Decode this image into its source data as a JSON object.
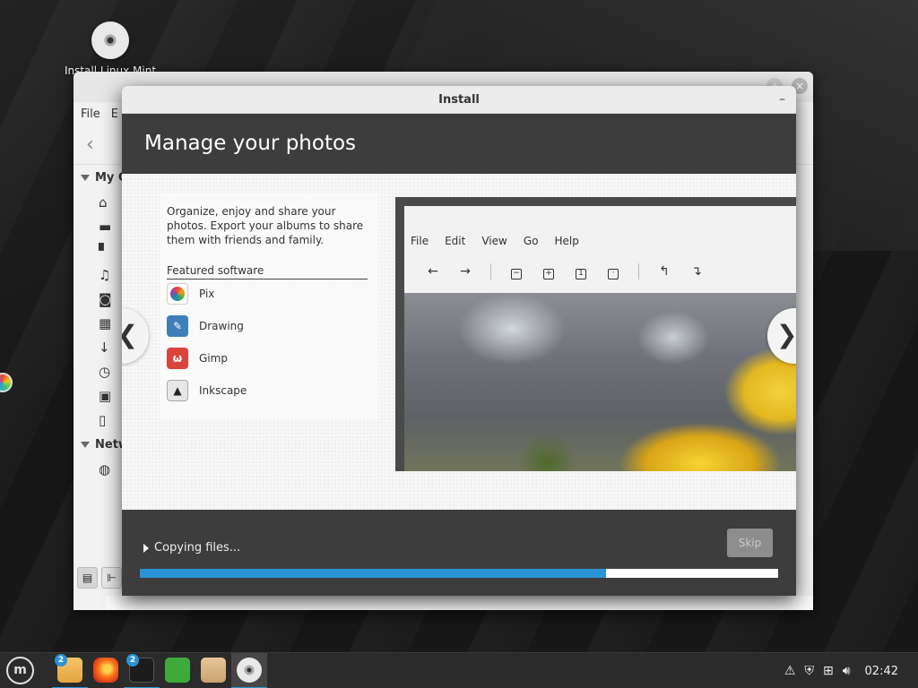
{
  "desktop": {
    "icon_label": "Install Linux Mint"
  },
  "file_manager": {
    "menu": [
      "File",
      "E"
    ],
    "sections": [
      "My C",
      "Netw"
    ],
    "items": [
      "home-icon",
      "desktop-icon",
      "documents-icon",
      "music-icon",
      "pictures-icon",
      "videos-icon",
      "downloads-icon",
      "recent-icon",
      "file-system-icon",
      "trash-icon"
    ],
    "network_items": [
      "network-icon"
    ]
  },
  "installer": {
    "window_title": "Install",
    "minimize_glyph": "–",
    "header": "Manage your photos",
    "description": "Organize, enjoy and share your photos. Export your albums to share them with friends and family.",
    "featured_heading": "Featured software",
    "apps": [
      {
        "name": "Pix",
        "icon": "pix-icon"
      },
      {
        "name": "Drawing",
        "icon": "drawing-icon"
      },
      {
        "name": "Gimp",
        "icon": "gimp-icon"
      },
      {
        "name": "Inkscape",
        "icon": "inkscape-icon"
      }
    ],
    "screenshot_menu": [
      "File",
      "Edit",
      "View",
      "Go",
      "Help"
    ],
    "status_text": "Copying files...",
    "skip_label": "Skip",
    "progress": 0.73
  },
  "taskbar": {
    "badges": {
      "files": "2",
      "terminal": "2"
    },
    "clock": "02:42"
  },
  "colors": {
    "accent": "#2a93d5",
    "installer_bg": "#3d3d3d",
    "content_bg": "#f7f7f7"
  }
}
